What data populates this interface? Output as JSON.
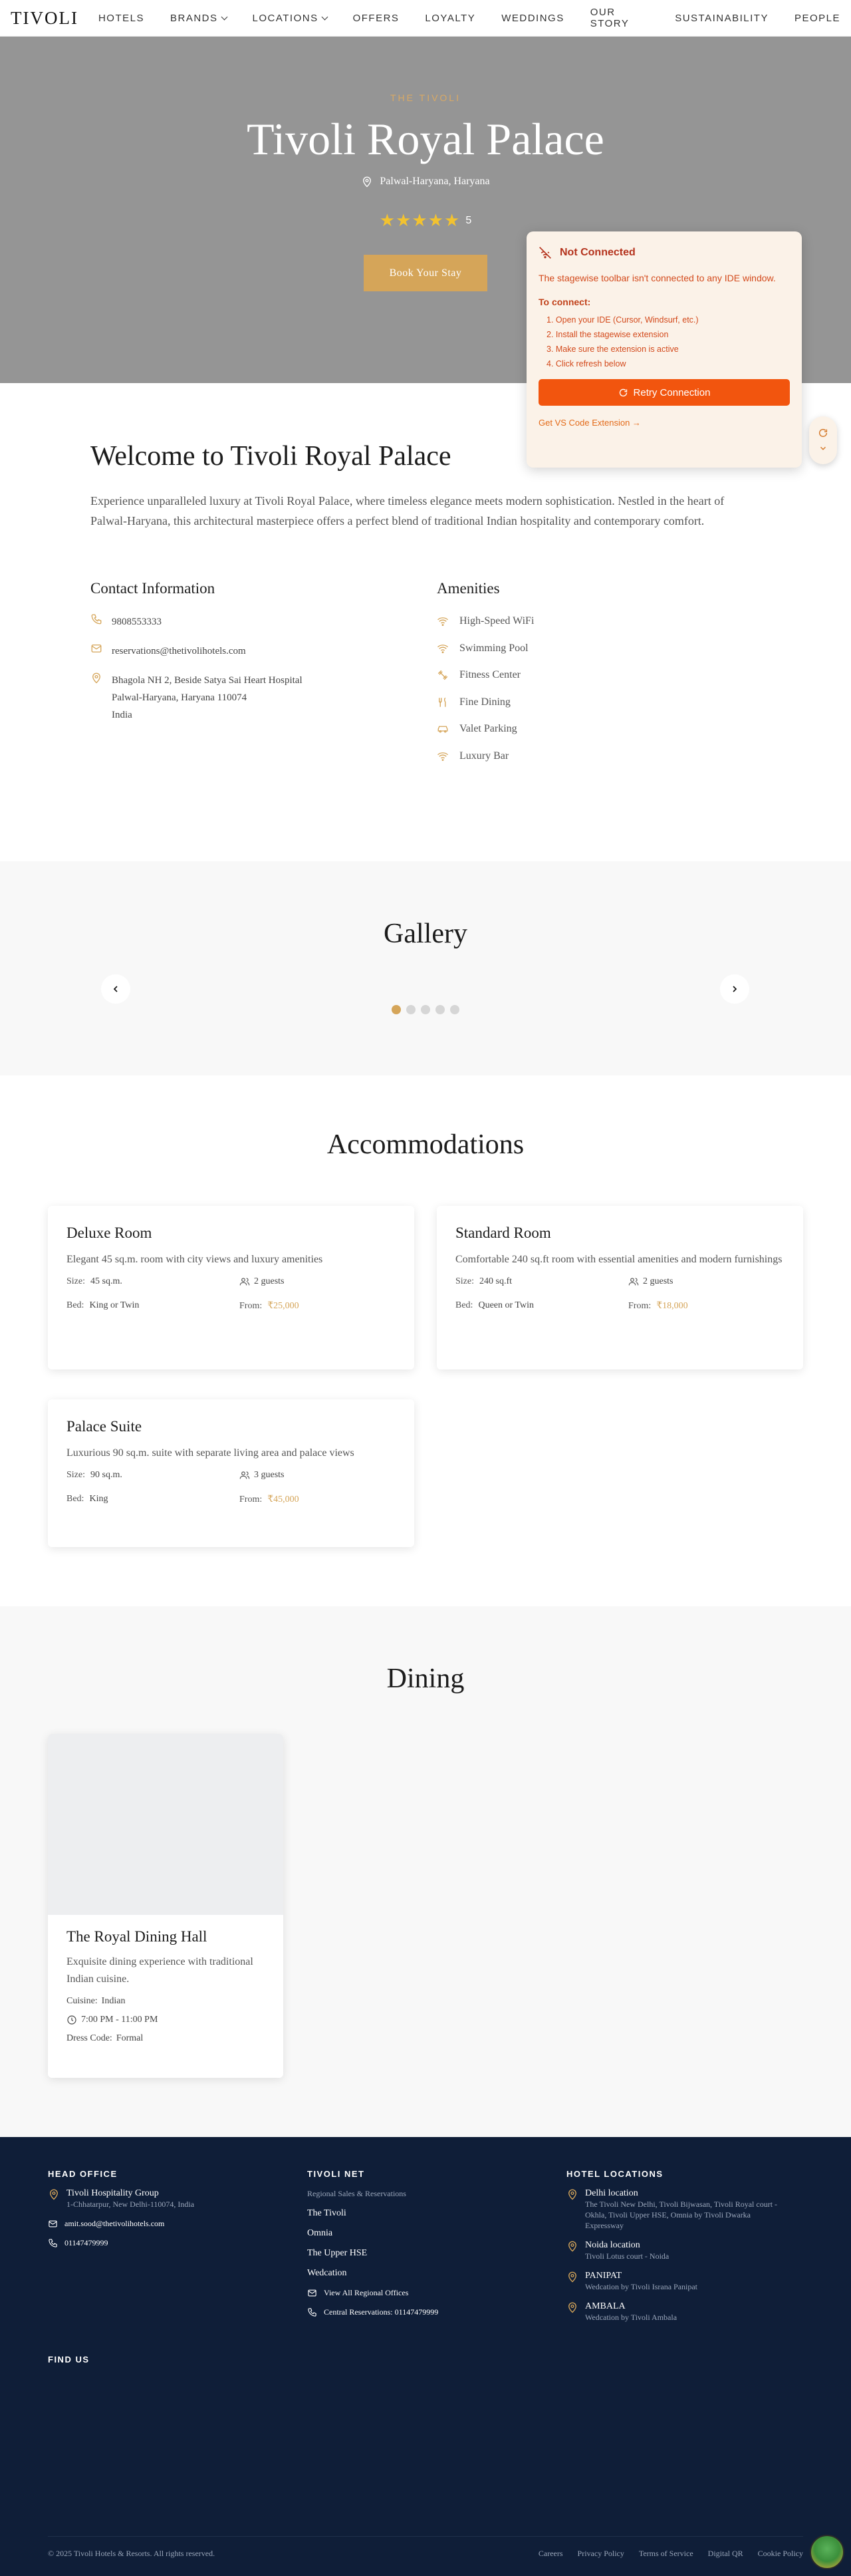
{
  "nav": {
    "logo": "TIVOLI",
    "items": [
      "HOTELS",
      "BRANDS",
      "LOCATIONS",
      "OFFERS",
      "LOYALTY",
      "WEDDINGS",
      "OUR STORY",
      "SUSTAINABILITY",
      "PEOPLE"
    ]
  },
  "hero": {
    "kicker": "THE TIVOLI",
    "title": "Tivoli Royal Palace",
    "location": "Palwal-Haryana, Haryana",
    "stars": "★★★★★",
    "rating": "5",
    "book_label": "Book Your Stay"
  },
  "toolbar": {
    "title": "Not Connected",
    "message": "The stagewise toolbar isn't connected to any IDE window.",
    "subtitle": "To connect:",
    "steps": [
      "1. Open your IDE (Cursor, Windsurf, etc.)",
      "2. Install the stagewise extension",
      "3. Make sure the extension is active",
      "4. Click refresh below"
    ],
    "retry_label": "Retry Connection",
    "link_label": "Get VS Code Extension →"
  },
  "welcome": {
    "title": "Welcome to Tivoli Royal Palace",
    "description": "Experience unparalleled luxury at Tivoli Royal Palace, where timeless elegance meets modern sophistication. Nestled in the heart of Palwal-Haryana, this architectural masterpiece offers a perfect blend of traditional Indian hospitality and contemporary comfort."
  },
  "contact": {
    "heading": "Contact Information",
    "phone": "9808553333",
    "email": "reservations@thetivolihotels.com",
    "address_line1": "Bhagola NH 2, Beside Satya Sai Heart Hospital",
    "address_line2": "Palwal-Haryana, Haryana 110074",
    "address_line3": "India"
  },
  "amenities": {
    "heading": "Amenities",
    "items": [
      "High-Speed WiFi",
      "Swimming Pool",
      "Fitness Center",
      "Fine Dining",
      "Valet Parking",
      "Luxury Bar"
    ]
  },
  "gallery": {
    "title": "Gallery"
  },
  "accommodations": {
    "title": "Accommodations",
    "size_label": "Size:",
    "bed_label": "Bed:",
    "from_label": "From:",
    "rooms": [
      {
        "name": "Deluxe Room",
        "desc": "Elegant 45 sq.m. room with city views and luxury amenities",
        "size": "45 sq.m.",
        "guests": "2 guests",
        "bed": "King or Twin",
        "price": "₹25,000"
      },
      {
        "name": "Standard Room",
        "desc": "Comfortable 240 sq.ft room with essential amenities and modern furnishings",
        "size": "240 sq.ft",
        "guests": "2 guests",
        "bed": "Queen or Twin",
        "price": "₹18,000"
      },
      {
        "name": "Palace Suite",
        "desc": "Luxurious 90 sq.m. suite with separate living area and palace views",
        "size": "90 sq.m.",
        "guests": "3 guests",
        "bed": "King",
        "price": "₹45,000"
      }
    ]
  },
  "dining": {
    "title": "Dining",
    "name": "The Royal Dining Hall",
    "desc": "Exquisite dining experience with traditional Indian cuisine.",
    "cuisine_label": "Cuisine:",
    "cuisine": "Indian",
    "hours": "7:00 PM - 11:00 PM",
    "dress_label": "Dress Code:",
    "dress": "Formal"
  },
  "footer": {
    "head_office": "HEAD OFFICE",
    "company": "Tivoli Hospitality Group",
    "company_addr": "1-Chhatarpur, New Delhi-110074, India",
    "email": "amit.sood@thetivolihotels.com",
    "phone": "01147479999",
    "tivoli_net": "TIVOLI NET",
    "regional": "Regional Sales & Reservations",
    "net_links": [
      "The Tivoli",
      "Omnia",
      "The Upper HSE",
      "Wedcation"
    ],
    "view_offices": "View All Regional Offices",
    "central_res": "Central Reservations: 01147479999",
    "hotel_locations": "HOTEL LOCATIONS",
    "locations": [
      {
        "name": "Delhi location",
        "detail": "The Tivoli New Delhi, Tivoli Bijwasan, Tivoli Royal court - Okhla, Tivoli Upper HSE, Omnia by Tivoli Dwarka Expressway"
      },
      {
        "name": "Noida location",
        "detail": "Tivoli Lotus court - Noida"
      },
      {
        "name": "PANIPAT",
        "detail": "Wedcation by Tivoli Israna Panipat"
      },
      {
        "name": "AMBALA",
        "detail": "Wedcation by Tivoli Ambala"
      }
    ],
    "find_us": "FIND US",
    "copyright": "© 2025 Tivoli Hotels & Resorts. All rights reserved.",
    "bottom_links": [
      "Careers",
      "Privacy Policy",
      "Terms of Service",
      "Digital QR",
      "Cookie Policy"
    ]
  },
  "colors": {
    "accent": "#d5a559",
    "footer_bg": "#0f1e38",
    "hero_bg": "#959595",
    "toolbar_orange": "#f2550e"
  }
}
